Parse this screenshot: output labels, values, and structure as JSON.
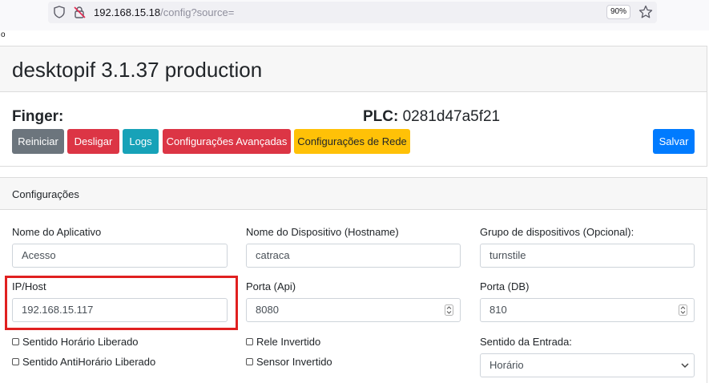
{
  "browser": {
    "url_host": "192.168.15.18",
    "url_path": "/config?source=",
    "zoom": "90%",
    "icons": [
      "shield-icon",
      "insecure-connection-icon",
      "star-icon"
    ]
  },
  "stray_text": "o",
  "header": {
    "title": "desktopif 3.1.37 production"
  },
  "status": {
    "finger_label": "Finger:",
    "plc_label": "PLC:",
    "plc_value": "0281d47a5f21"
  },
  "actions": {
    "reiniciar": "Reiniciar",
    "desligar": "Desligar",
    "logs": "Logs",
    "avancadas": "Configurações Avançadas",
    "rede": "Configurações de Rede",
    "salvar": "Salvar"
  },
  "config": {
    "title": "Configurações",
    "app_name": {
      "label": "Nome do Aplicativo",
      "value": "Acesso"
    },
    "hostname": {
      "label": "Nome do Dispositivo (Hostname)",
      "value": "catraca"
    },
    "device_group": {
      "label": "Grupo de dispositivos (Opcional):",
      "value": "turnstile"
    },
    "ip_host": {
      "label": "IP/Host",
      "value": "192.168.15.117"
    },
    "port_api": {
      "label": "Porta (Api)",
      "value": "8080"
    },
    "port_db": {
      "label": "Porta (DB)",
      "value": "810"
    },
    "checkboxes": {
      "horario": "Sentido Horário Liberado",
      "antihorario": "Sentido AntiHorário Liberado",
      "rele": "Rele Invertido",
      "sensor": "Sensor Invertido"
    },
    "direction": {
      "label": "Sentido da Entrada:",
      "selected": "Horário"
    }
  },
  "colors": {
    "secondary": "#6c757d",
    "danger": "#dc3545",
    "info": "#17a2b8",
    "warning": "#ffc107",
    "primary": "#007bff",
    "highlight": "#e02020"
  }
}
